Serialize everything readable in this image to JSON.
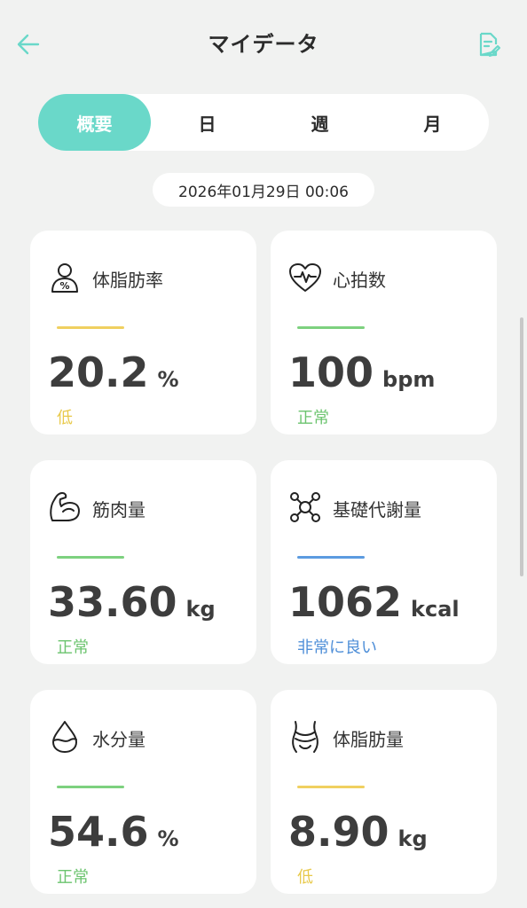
{
  "header": {
    "title": "マイデータ",
    "back_icon": "arrow-left-icon",
    "report_icon": "edit-document-icon"
  },
  "tabs": [
    {
      "label": "概要",
      "active": true
    },
    {
      "label": "日",
      "active": false
    },
    {
      "label": "週",
      "active": false
    },
    {
      "label": "月",
      "active": false
    }
  ],
  "timestamp": "2026年01月29日 00:06",
  "colors": {
    "accent": "#6ad8c9",
    "yellow": "#f0d060",
    "green": "#7dd17f",
    "blue": "#5c9be0"
  },
  "metrics": [
    {
      "label": "体脂肪率",
      "value": "20.2",
      "unit": "%",
      "status": "低",
      "status_color": "#e8c94a",
      "bar_color": "#f0d060",
      "icon": "body-fat-percent-icon"
    },
    {
      "label": "心拍数",
      "value": "100",
      "unit": "bpm",
      "status": "正常",
      "status_color": "#6cc46f",
      "bar_color": "#7dd17f",
      "icon": "heart-rate-icon"
    },
    {
      "label": "筋肉量",
      "value": "33.60",
      "unit": "kg",
      "status": "正常",
      "status_color": "#6cc46f",
      "bar_color": "#7dd17f",
      "icon": "muscle-arm-icon"
    },
    {
      "label": "基礎代謝量",
      "value": "1062",
      "unit": "kcal",
      "status": "非常に良い",
      "status_color": "#4f8fd8",
      "bar_color": "#5c9be0",
      "icon": "metabolism-molecule-icon"
    },
    {
      "label": "水分量",
      "value": "54.6",
      "unit": "%",
      "status": "正常",
      "status_color": "#6cc46f",
      "bar_color": "#7dd17f",
      "icon": "water-drop-icon"
    },
    {
      "label": "体脂肪量",
      "value": "8.90",
      "unit": "kg",
      "status": "低",
      "status_color": "#e8c94a",
      "bar_color": "#f0d060",
      "icon": "waist-icon"
    }
  ]
}
